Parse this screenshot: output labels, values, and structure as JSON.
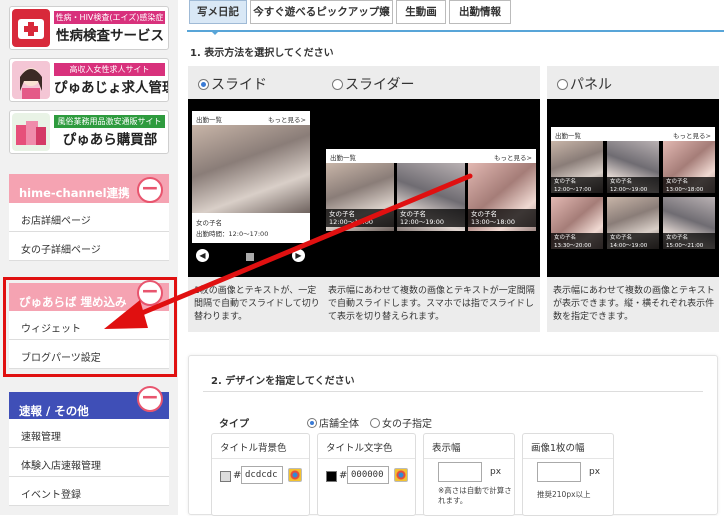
{
  "sidebar": {
    "banners": [
      {
        "tag": "性病・HIV検査(エイズ)感染症",
        "title": "性病検査サービス",
        "tag_color": "#d8317c"
      },
      {
        "tag": "高収入女性求人サイト",
        "title": "ぴゅあじょ求人管理",
        "tag_color": "#d8317c"
      },
      {
        "tag": "風俗業務用品激安通販サイト",
        "title": "ぴゅあら購買部",
        "tag_color": "#2e9b3e"
      }
    ],
    "sections": [
      {
        "title": "hime-channel連携",
        "color": "#f5a3b2",
        "items": [
          "お店詳細ページ",
          "女の子詳細ページ"
        ]
      },
      {
        "title": "ぴゅあらば 埋め込み",
        "color": "#f5a3b2",
        "items": [
          "ウィジェット",
          "ブログパーツ設定"
        ]
      },
      {
        "title": "速報 / その他",
        "color": "#3f4fb7",
        "items": [
          "速報管理",
          "体験入店速報管理",
          "イベント登録"
        ]
      }
    ],
    "toggle_symbol": "−"
  },
  "tabs": [
    {
      "label": "写メ日記",
      "active": true
    },
    {
      "label": "今すぐ遊べるピックアップ嬢",
      "active": false
    },
    {
      "label": "生動画",
      "active": false
    },
    {
      "label": "出勤情報",
      "active": false
    }
  ],
  "step1": {
    "title": "1. 表示方法を選択してください",
    "options": [
      {
        "label": "スライド",
        "selected": true,
        "desc": "1枚の画像とテキストが、一定間隔で自動でスライドして切り替わります。"
      },
      {
        "label": "スライダー",
        "selected": false,
        "desc": "表示幅にあわせて複数の画像とテキストが一定間隔で自動スライドします。スマホでは指でスライドして表示を切り替えられます。"
      },
      {
        "label": "パネル",
        "selected": false,
        "desc": "表示幅にあわせて複数の画像とテキストが表示できます。縦・横それぞれ表示件数を指定できます。"
      }
    ],
    "preview": {
      "header": "出勤一覧",
      "more": "もっと見る>",
      "name": "女の子名",
      "slide_time": "出勤時間：12:0〜17:00",
      "slider_times": [
        "12:00〜17:00",
        "12:00〜19:00",
        "13:00〜18:00"
      ],
      "panel_times": [
        "12:00〜17:00",
        "12:00〜19:00",
        "13:00〜18:00",
        "13:30〜20:00",
        "14:00〜19:00",
        "15:00〜21:00"
      ]
    }
  },
  "step2": {
    "title": "2. デザインを指定してください",
    "type_label": "タイプ",
    "type_options": [
      {
        "label": "店舗全体",
        "selected": true
      },
      {
        "label": "女の子指定",
        "selected": false
      }
    ],
    "fields": [
      {
        "label": "タイトル背景色",
        "hash": "#",
        "value": "dcdcdc",
        "swatch": "#dcdcdc"
      },
      {
        "label": "タイトル文字色",
        "hash": "#",
        "value": "000000",
        "swatch": "#000000"
      },
      {
        "label": "表示幅",
        "unit": "px",
        "note": "※高さは自動で計算されます。"
      },
      {
        "label": "画像1枚の幅",
        "unit": "px",
        "note": "推奨210px以上"
      }
    ]
  },
  "colors": {
    "accent": "#58a5d8",
    "highlight": "#e01010"
  }
}
